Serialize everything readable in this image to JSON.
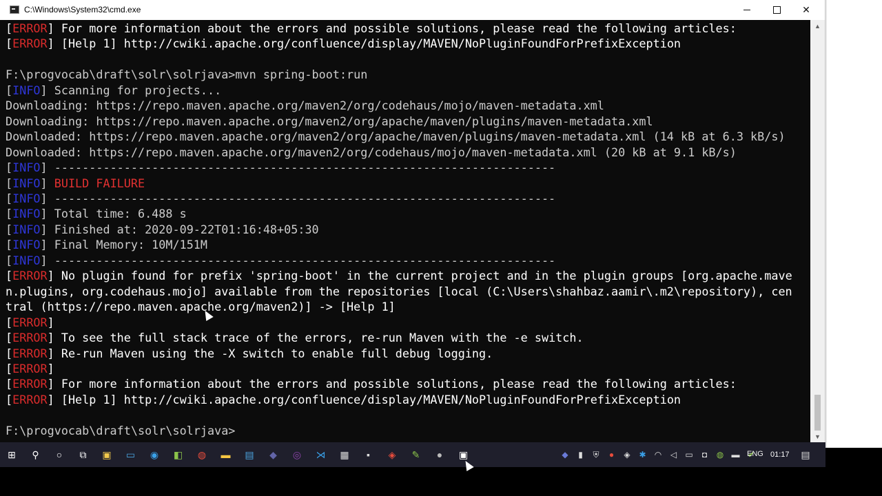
{
  "window": {
    "title": "C:\\Windows\\System32\\cmd.exe",
    "min_glyph": "",
    "max_glyph": "",
    "close_glyph": "✕"
  },
  "console": {
    "lines": [
      [
        {
          "t": "[",
          "c": "wht"
        },
        {
          "t": "ERROR",
          "c": "err"
        },
        {
          "t": "] For more information about the errors and possible solutions, please read the following articles:",
          "c": "wht"
        }
      ],
      [
        {
          "t": "[",
          "c": "wht"
        },
        {
          "t": "ERROR",
          "c": "err"
        },
        {
          "t": "] [Help 1] http://cwiki.apache.org/confluence/display/MAVEN/NoPluginFoundForPrefixException",
          "c": "wht"
        }
      ],
      [
        {
          "t": "",
          "c": ""
        }
      ],
      [
        {
          "t": "F:\\progvocab\\draft\\solr\\solrjava>mvn spring-boot:run",
          "c": ""
        }
      ],
      [
        {
          "t": "[",
          "c": ""
        },
        {
          "t": "INFO",
          "c": "info"
        },
        {
          "t": "] Scanning for projects...",
          "c": ""
        }
      ],
      [
        {
          "t": "Downloading: https://repo.maven.apache.org/maven2/org/codehaus/mojo/maven-metadata.xml",
          "c": ""
        }
      ],
      [
        {
          "t": "Downloading: https://repo.maven.apache.org/maven2/org/apache/maven/plugins/maven-metadata.xml",
          "c": ""
        }
      ],
      [
        {
          "t": "Downloaded: https://repo.maven.apache.org/maven2/org/apache/maven/plugins/maven-metadata.xml (14 kB at 6.3 kB/s)",
          "c": ""
        }
      ],
      [
        {
          "t": "Downloaded: https://repo.maven.apache.org/maven2/org/codehaus/mojo/maven-metadata.xml (20 kB at 9.1 kB/s)",
          "c": ""
        }
      ],
      [
        {
          "t": "[",
          "c": ""
        },
        {
          "t": "INFO",
          "c": "info"
        },
        {
          "t": "] ------------------------------------------------------------------------",
          "c": ""
        }
      ],
      [
        {
          "t": "[",
          "c": ""
        },
        {
          "t": "INFO",
          "c": "info"
        },
        {
          "t": "] ",
          "c": ""
        },
        {
          "t": "BUILD FAILURE",
          "c": "fail"
        }
      ],
      [
        {
          "t": "[",
          "c": ""
        },
        {
          "t": "INFO",
          "c": "info"
        },
        {
          "t": "] ------------------------------------------------------------------------",
          "c": ""
        }
      ],
      [
        {
          "t": "[",
          "c": ""
        },
        {
          "t": "INFO",
          "c": "info"
        },
        {
          "t": "] Total time: 6.488 s",
          "c": ""
        }
      ],
      [
        {
          "t": "[",
          "c": ""
        },
        {
          "t": "INFO",
          "c": "info"
        },
        {
          "t": "] Finished at: 2020-09-22T01:16:48+05:30",
          "c": ""
        }
      ],
      [
        {
          "t": "[",
          "c": ""
        },
        {
          "t": "INFO",
          "c": "info"
        },
        {
          "t": "] Final Memory: 10M/151M",
          "c": ""
        }
      ],
      [
        {
          "t": "[",
          "c": ""
        },
        {
          "t": "INFO",
          "c": "info"
        },
        {
          "t": "] ------------------------------------------------------------------------",
          "c": ""
        }
      ],
      [
        {
          "t": "[",
          "c": "wht"
        },
        {
          "t": "ERROR",
          "c": "err"
        },
        {
          "t": "] No plugin found for prefix 'spring-boot' in the current project and in the plugin groups [org.apache.mave",
          "c": "wht"
        }
      ],
      [
        {
          "t": "n.plugins, org.codehaus.mojo] available from the repositories [local (C:\\Users\\shahbaz.aamir\\.m2\\repository), cen",
          "c": "wht"
        }
      ],
      [
        {
          "t": "tral (https://repo.maven.apache.org/maven2)] -> [Help 1]",
          "c": "wht"
        }
      ],
      [
        {
          "t": "[",
          "c": "wht"
        },
        {
          "t": "ERROR",
          "c": "err"
        },
        {
          "t": "]",
          "c": "wht"
        }
      ],
      [
        {
          "t": "[",
          "c": "wht"
        },
        {
          "t": "ERROR",
          "c": "err"
        },
        {
          "t": "] To see the full stack trace of the errors, re-run Maven with the -e switch.",
          "c": "wht"
        }
      ],
      [
        {
          "t": "[",
          "c": "wht"
        },
        {
          "t": "ERROR",
          "c": "err"
        },
        {
          "t": "] Re-run Maven using the -X switch to enable full debug logging.",
          "c": "wht"
        }
      ],
      [
        {
          "t": "[",
          "c": "wht"
        },
        {
          "t": "ERROR",
          "c": "err"
        },
        {
          "t": "]",
          "c": "wht"
        }
      ],
      [
        {
          "t": "[",
          "c": "wht"
        },
        {
          "t": "ERROR",
          "c": "err"
        },
        {
          "t": "] For more information about the errors and possible solutions, please read the following articles:",
          "c": "wht"
        }
      ],
      [
        {
          "t": "[",
          "c": "wht"
        },
        {
          "t": "ERROR",
          "c": "err"
        },
        {
          "t": "] [Help 1] http://cwiki.apache.org/confluence/display/MAVEN/NoPluginFoundForPrefixException",
          "c": "wht"
        }
      ],
      [
        {
          "t": "",
          "c": ""
        }
      ],
      [
        {
          "t": "F:\\progvocab\\draft\\solr\\solrjava>",
          "c": ""
        }
      ]
    ]
  },
  "scrollbar": {
    "up": "▲",
    "down": "▼"
  },
  "taskbar": {
    "icons": [
      {
        "name": "start-icon",
        "glyph": "⊞",
        "color": "#ffffff"
      },
      {
        "name": "search-icon",
        "glyph": "⚲",
        "color": "#ffffff"
      },
      {
        "name": "cortana-icon",
        "glyph": "○",
        "color": "#ffffff"
      },
      {
        "name": "task-view-icon",
        "glyph": "⧉",
        "color": "#ffffff"
      },
      {
        "name": "store-icon",
        "glyph": "▣",
        "color": "#f2c94c"
      },
      {
        "name": "remote-desktop-icon",
        "glyph": "▭",
        "color": "#4aa3df"
      },
      {
        "name": "edge-icon",
        "glyph": "◉",
        "color": "#3aa0e8"
      },
      {
        "name": "app-green-icon",
        "glyph": "◧",
        "color": "#8bc34a"
      },
      {
        "name": "chrome-icon",
        "glyph": "◍",
        "color": "#e74c3c"
      },
      {
        "name": "file-explorer-icon",
        "glyph": "▬",
        "color": "#f5c542"
      },
      {
        "name": "app-blue-icon",
        "glyph": "▤",
        "color": "#4aa3df"
      },
      {
        "name": "teams-icon",
        "glyph": "◆",
        "color": "#6264a7"
      },
      {
        "name": "obs-icon",
        "glyph": "◎",
        "color": "#8e44ad"
      },
      {
        "name": "vscode-icon",
        "glyph": "⋊",
        "color": "#3aa0e8"
      },
      {
        "name": "text-editor-icon",
        "glyph": "▦",
        "color": "#dddddd"
      },
      {
        "name": "cmd-icon",
        "glyph": "▪",
        "color": "#dddddd"
      },
      {
        "name": "acrobat-icon",
        "glyph": "◈",
        "color": "#e74c3c"
      },
      {
        "name": "notepad-icon",
        "glyph": "✎",
        "color": "#8bc34a"
      },
      {
        "name": "app-dark-icon",
        "glyph": "●",
        "color": "#bbbbbb"
      },
      {
        "name": "terminal-active-icon",
        "glyph": "▣",
        "color": "#ffffff"
      }
    ],
    "tray": [
      {
        "name": "teams-tray-icon",
        "glyph": "◆",
        "color": "#6a7bd8"
      },
      {
        "name": "mic-icon",
        "glyph": "▮",
        "color": "#dddddd"
      },
      {
        "name": "shield-icon",
        "glyph": "⛨",
        "color": "#dddddd"
      },
      {
        "name": "red-app-icon",
        "glyph": "●",
        "color": "#e74c3c"
      },
      {
        "name": "defender-icon",
        "glyph": "◈",
        "color": "#dddddd"
      },
      {
        "name": "bluetooth-icon",
        "glyph": "✱",
        "color": "#3aa0e8"
      },
      {
        "name": "wifi-icon",
        "glyph": "◠",
        "color": "#dddddd"
      },
      {
        "name": "volume-icon",
        "glyph": "◁",
        "color": "#dddddd"
      },
      {
        "name": "display-icon",
        "glyph": "▭",
        "color": "#dddddd"
      },
      {
        "name": "camera-icon",
        "glyph": "◘",
        "color": "#dddddd"
      },
      {
        "name": "chrome-tray-icon",
        "glyph": "◍",
        "color": "#8bc34a"
      },
      {
        "name": "battery-icon",
        "glyph": "▬",
        "color": "#dddddd"
      },
      {
        "name": "check-icon",
        "glyph": "✔",
        "color": "#8bc34a"
      }
    ],
    "language": "ENG",
    "time": "01:17",
    "notification_glyph": "▤"
  }
}
